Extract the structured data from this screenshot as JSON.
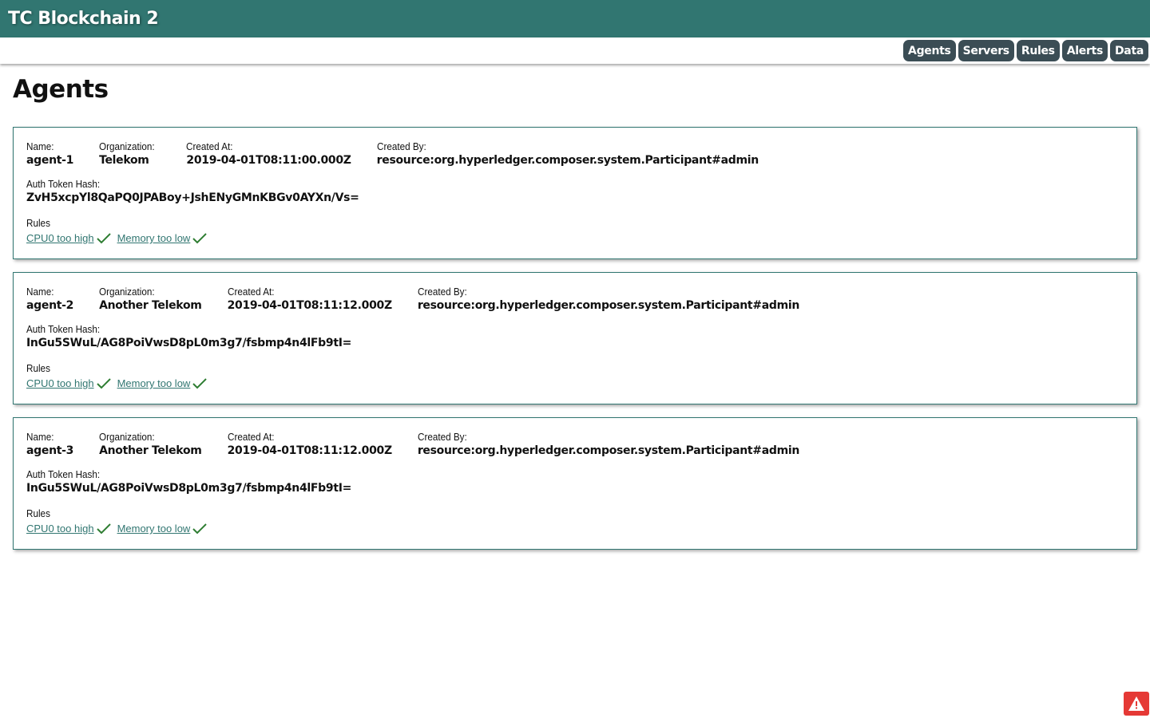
{
  "app": {
    "title": "TC Blockchain 2"
  },
  "nav": [
    {
      "label": "Agents"
    },
    {
      "label": "Servers"
    },
    {
      "label": "Rules"
    },
    {
      "label": "Alerts"
    },
    {
      "label": "Data"
    }
  ],
  "page": {
    "title": "Agents"
  },
  "labels": {
    "name": "Name:",
    "organization": "Organization:",
    "created_at": "Created At:",
    "created_by": "Created By:",
    "auth_token_hash": "Auth Token Hash:",
    "rules": "Rules"
  },
  "agents": [
    {
      "name": "agent-1",
      "organization": "Telekom",
      "created_at": "2019-04-01T08:11:00.000Z",
      "created_by": "resource:org.hyperledger.composer.system.Participant#admin",
      "auth_token_hash": "ZvH5xcpYl8QaPQ0JPABoy+JshENyGMnKBGv0AYXn/Vs=",
      "rules": [
        {
          "label": "CPU0 too high",
          "status_icon": "check-icon"
        },
        {
          "label": "Memory too low",
          "status_icon": "check-icon"
        }
      ]
    },
    {
      "name": "agent-2",
      "organization": "Another Telekom",
      "created_at": "2019-04-01T08:11:12.000Z",
      "created_by": "resource:org.hyperledger.composer.system.Participant#admin",
      "auth_token_hash": "InGu5SWuL/AG8PoiVwsD8pL0m3g7/fsbmp4n4lFb9tI=",
      "rules": [
        {
          "label": "CPU0 too high",
          "status_icon": "check-icon"
        },
        {
          "label": "Memory too low",
          "status_icon": "check-icon"
        }
      ]
    },
    {
      "name": "agent-3",
      "organization": "Another Telekom",
      "created_at": "2019-04-01T08:11:12.000Z",
      "created_by": "resource:org.hyperledger.composer.system.Participant#admin",
      "auth_token_hash": "InGu5SWuL/AG8PoiVwsD8pL0m3g7/fsbmp4n4lFb9tI=",
      "rules": [
        {
          "label": "CPU0 too high",
          "status_icon": "check-icon"
        },
        {
          "label": "Memory too low",
          "status_icon": "check-icon"
        }
      ]
    }
  ],
  "alert_button": {
    "icon": "warning-icon"
  },
  "colors": {
    "header_bg": "#317671",
    "nav_button_bg": "#3b4d55",
    "link": "#317671",
    "check": "#2e7d32",
    "alert": "#e53935"
  }
}
